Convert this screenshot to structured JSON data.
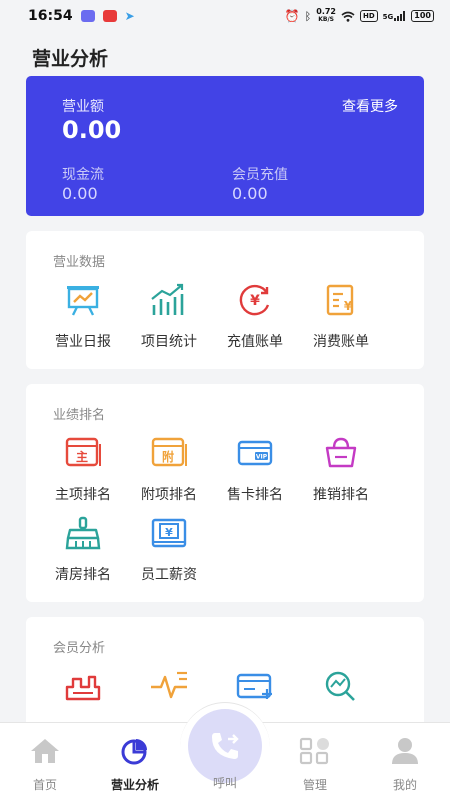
{
  "status_bar": {
    "time": "16:54",
    "net_speed_value": "0.72",
    "net_speed_unit": "KB/S",
    "hd": "HD",
    "signal_label": "5G",
    "battery": "100"
  },
  "page": {
    "title": "营业分析"
  },
  "revenue_card": {
    "revenue_label": "营业额",
    "revenue_value": "0.00",
    "more_link": "查看更多",
    "cashflow_label": "现金流",
    "cashflow_value": "0.00",
    "member_recharge_label": "会员充值",
    "member_recharge_value": "0.00",
    "background_color": "#4243e6"
  },
  "business_data": {
    "title": "营业数据",
    "items": [
      {
        "label": "营业日报",
        "icon": "presentation-board-icon",
        "color": "#3ab0e2"
      },
      {
        "label": "项目统计",
        "icon": "bar-chart-trend-icon",
        "color": "#2ba39a"
      },
      {
        "label": "充值账单",
        "icon": "yen-refresh-icon",
        "color": "#e03b3b"
      },
      {
        "label": "消费账单",
        "icon": "yen-document-icon",
        "color": "#f0a23a"
      }
    ]
  },
  "performance_ranking": {
    "title": "业绩排名",
    "items": [
      {
        "label": "主项排名",
        "icon": "main-item-card-icon",
        "color": "#e64a3c",
        "glyph": "主"
      },
      {
        "label": "附项排名",
        "icon": "addon-item-card-icon",
        "color": "#f0a23a",
        "glyph": "附"
      },
      {
        "label": "售卡排名",
        "icon": "vip-card-icon",
        "color": "#3a8ee6",
        "glyph": "VIP"
      },
      {
        "label": "推销排名",
        "icon": "shopping-basket-icon",
        "color": "#c43ac4"
      },
      {
        "label": "清房排名",
        "icon": "cleaning-broom-icon",
        "color": "#2ba39a"
      },
      {
        "label": "员工薪资",
        "icon": "salary-yen-icon",
        "color": "#3a8ee6"
      }
    ]
  },
  "member_analysis": {
    "title": "会员分析",
    "items": [
      {
        "icon": "member-growth-icon",
        "color": "#e03b3b"
      },
      {
        "icon": "pulse-trend-icon",
        "color": "#f0a23a"
      },
      {
        "icon": "member-card-add-icon",
        "color": "#3a8ee6"
      },
      {
        "icon": "search-trend-icon",
        "color": "#2ba39a"
      }
    ]
  },
  "bottom_nav": {
    "items": [
      {
        "label": "首页",
        "icon": "home-icon",
        "active": false
      },
      {
        "label": "营业分析",
        "icon": "pie-chart-icon",
        "active": true
      },
      {
        "label": "呼叫",
        "icon": "phone-call-icon",
        "active": false
      },
      {
        "label": "管理",
        "icon": "grid-manage-icon",
        "active": false
      },
      {
        "label": "我的",
        "icon": "user-profile-icon",
        "active": false
      }
    ]
  }
}
